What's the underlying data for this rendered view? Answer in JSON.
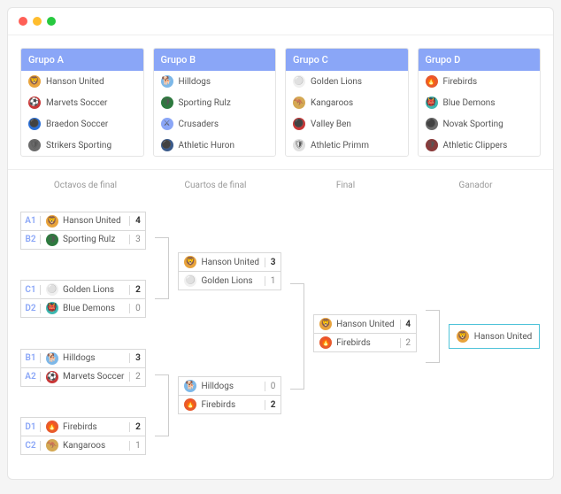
{
  "groups": [
    {
      "title": "Grupo A",
      "teams": [
        {
          "name": "Hanson United",
          "icon": "🦁",
          "bg": "#e8a33c"
        },
        {
          "name": "Marvets Soccer",
          "icon": "⚽",
          "bg": "#c83737"
        },
        {
          "name": "Braedon Soccer",
          "icon": "⚫",
          "bg": "#2a6fd6"
        },
        {
          "name": "Strikers Sporting",
          "icon": "🛡",
          "bg": "#6b6b6b"
        }
      ]
    },
    {
      "title": "Grupo B",
      "teams": [
        {
          "name": "Hilldogs",
          "icon": "🐕",
          "bg": "#7db8e8"
        },
        {
          "name": "Sporting Rulz",
          "icon": "🛡",
          "bg": "#2d7a3e"
        },
        {
          "name": "Crusaders",
          "icon": "⚔",
          "bg": "#8aa6f7"
        },
        {
          "name": "Athletic Huron",
          "icon": "⚫",
          "bg": "#3a5a8a"
        }
      ]
    },
    {
      "title": "Grupo C",
      "teams": [
        {
          "name": "Golden Lions",
          "icon": "⚪",
          "bg": "#f0f0f0"
        },
        {
          "name": "Kangaroos",
          "icon": "🦘",
          "bg": "#d4a853"
        },
        {
          "name": "Valley Ben",
          "icon": "⚫",
          "bg": "#c83737"
        },
        {
          "name": "Athletic Primm",
          "icon": "🛡",
          "bg": "#e0e0e0"
        }
      ]
    },
    {
      "title": "Grupo D",
      "teams": [
        {
          "name": "Firebirds",
          "icon": "🔥",
          "bg": "#e85a2c"
        },
        {
          "name": "Blue Demons",
          "icon": "👹",
          "bg": "#3eb8b0"
        },
        {
          "name": "Novak Sporting",
          "icon": "⚫",
          "bg": "#6b6b6b"
        },
        {
          "name": "Athletic Clippers",
          "icon": "🛡",
          "bg": "#8a3a3a"
        }
      ]
    }
  ],
  "stages": [
    "Octavos de final",
    "Cuartos de final",
    "Final",
    "Ganador"
  ],
  "r16": [
    {
      "rows": [
        {
          "seed": "A1",
          "name": "Hanson United",
          "icon": "🦁",
          "bg": "#e8a33c",
          "score": "4",
          "win": true
        },
        {
          "seed": "B2",
          "name": "Sporting Rulz",
          "icon": "🛡",
          "bg": "#2d7a3e",
          "score": "3"
        }
      ]
    },
    {
      "rows": [
        {
          "seed": "C1",
          "name": "Golden Lions",
          "icon": "⚪",
          "bg": "#f0f0f0",
          "score": "2",
          "win": true
        },
        {
          "seed": "D2",
          "name": "Blue Demons",
          "icon": "👹",
          "bg": "#3eb8b0",
          "score": "0"
        }
      ]
    },
    {
      "rows": [
        {
          "seed": "B1",
          "name": "Hilldogs",
          "icon": "🐕",
          "bg": "#7db8e8",
          "score": "3",
          "win": true
        },
        {
          "seed": "A2",
          "name": "Marvets Soccer",
          "icon": "⚽",
          "bg": "#c83737",
          "score": "2"
        }
      ]
    },
    {
      "rows": [
        {
          "seed": "D1",
          "name": "Firebirds",
          "icon": "🔥",
          "bg": "#e85a2c",
          "score": "2",
          "win": true
        },
        {
          "seed": "C2",
          "name": "Kangaroos",
          "icon": "🦘",
          "bg": "#d4a853",
          "score": "1"
        }
      ]
    }
  ],
  "qf": [
    {
      "rows": [
        {
          "name": "Hanson United",
          "icon": "🦁",
          "bg": "#e8a33c",
          "score": "3",
          "win": true
        },
        {
          "name": "Golden Lions",
          "icon": "⚪",
          "bg": "#f0f0f0",
          "score": "1"
        }
      ]
    },
    {
      "rows": [
        {
          "name": "Hilldogs",
          "icon": "🐕",
          "bg": "#7db8e8",
          "score": "0"
        },
        {
          "name": "Firebirds",
          "icon": "🔥",
          "bg": "#e85a2c",
          "score": "2",
          "win": true
        }
      ]
    }
  ],
  "final": [
    {
      "rows": [
        {
          "name": "Hanson United",
          "icon": "🦁",
          "bg": "#e8a33c",
          "score": "4",
          "win": true
        },
        {
          "name": "Firebirds",
          "icon": "🔥",
          "bg": "#e85a2c",
          "score": "2"
        }
      ]
    }
  ],
  "winner": {
    "name": "Hanson United",
    "icon": "🦁",
    "bg": "#e8a33c"
  }
}
